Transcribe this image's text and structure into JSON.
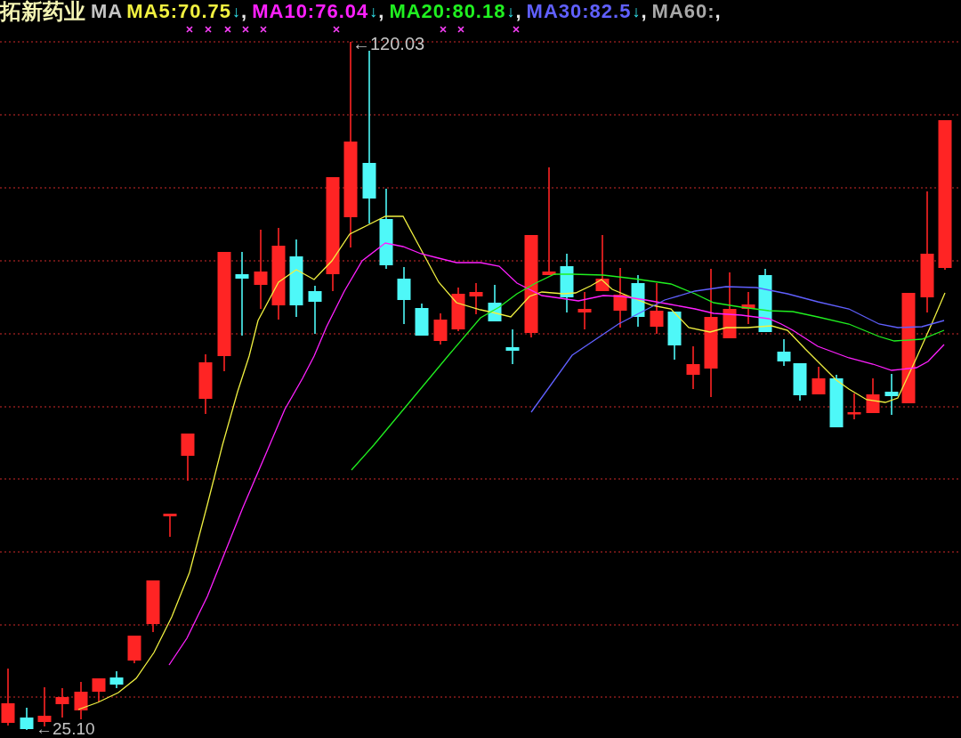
{
  "stock_name": "拓新药业",
  "indicator": "MA",
  "moving_averages": [
    {
      "label": "MA5:70.75",
      "trend_arrow": "↓",
      "separator": ",",
      "color": "#f0f040"
    },
    {
      "label": "MA10:76.04",
      "trend_arrow": "↓",
      "separator": ",",
      "color": "#ff20ff"
    },
    {
      "label": "MA20:80.18",
      "trend_arrow": "↓",
      "separator": ",",
      "color": "#20f020"
    },
    {
      "label": "MA30:82.5",
      "trend_arrow": "↓",
      "separator": ",",
      "color": "#6060ff"
    },
    {
      "label": "MA60:",
      "separator": ",",
      "color": "#a8a8a8"
    }
  ],
  "price_chart": {
    "high_label": "←120.03",
    "low_label": "←25.10"
  }
}
